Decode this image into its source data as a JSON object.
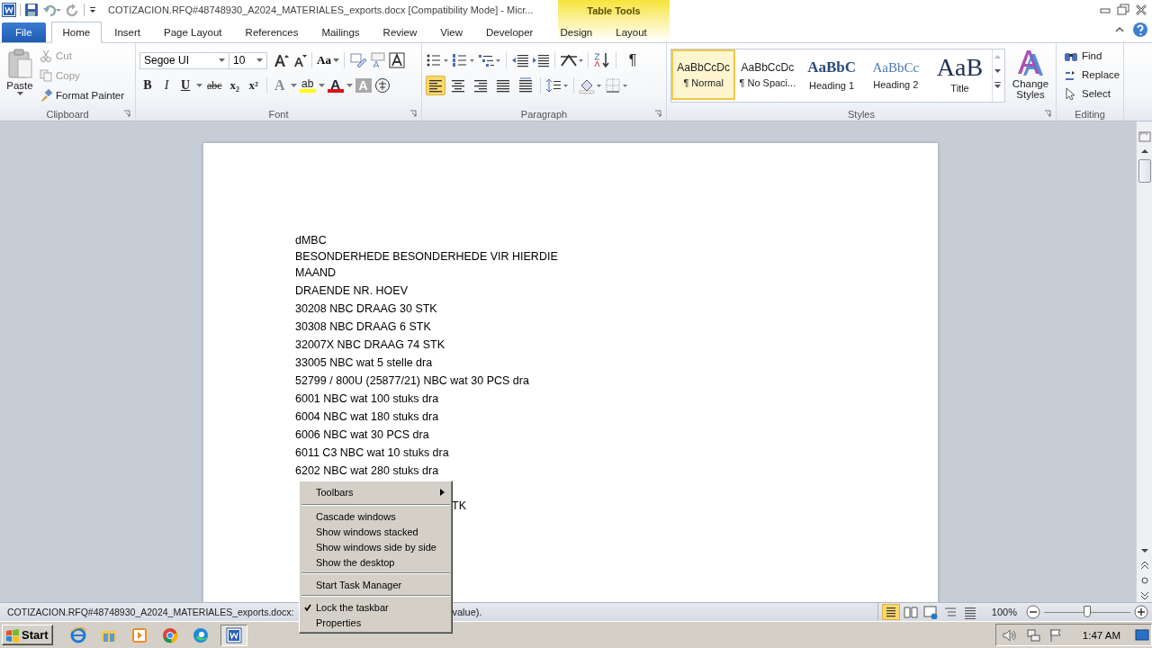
{
  "window": {
    "title": "COTIZACION.RFQ#48748930_A2024_MATERIALES_exports.docx [Compatibility Mode]  -  Micr...",
    "contextual_group": "Table Tools"
  },
  "tabs": [
    {
      "label": "File",
      "kind": "file",
      "selected": false
    },
    {
      "label": "Home",
      "kind": "plain",
      "selected": true
    },
    {
      "label": "Insert",
      "kind": "plain",
      "selected": false
    },
    {
      "label": "Page Layout",
      "kind": "plain",
      "selected": false
    },
    {
      "label": "References",
      "kind": "plain",
      "selected": false
    },
    {
      "label": "Mailings",
      "kind": "plain",
      "selected": false
    },
    {
      "label": "Review",
      "kind": "plain",
      "selected": false
    },
    {
      "label": "View",
      "kind": "plain",
      "selected": false
    },
    {
      "label": "Developer",
      "kind": "plain",
      "selected": false
    },
    {
      "label": "Design",
      "kind": "contextual",
      "selected": false
    },
    {
      "label": "Layout",
      "kind": "contextual",
      "selected": false
    }
  ],
  "clipboard": {
    "label": "Clipboard",
    "paste": "Paste",
    "cut": {
      "label": "Cut",
      "disabled": true
    },
    "copy": {
      "label": "Copy",
      "disabled": true
    },
    "format_painter": "Format Painter"
  },
  "font": {
    "label": "Font",
    "face": "Segoe UI",
    "size": "10",
    "case_glyph": "Aa",
    "format_buttons": [
      {
        "glyph": "B",
        "kind": "bold"
      },
      {
        "glyph": "I",
        "kind": "italic"
      },
      {
        "glyph": "U",
        "kind": "underline"
      },
      {
        "glyph": "abc",
        "kind": "strike"
      },
      {
        "glyph": "x₂",
        "kind": "plain"
      },
      {
        "glyph": "x²",
        "kind": "plain"
      },
      {
        "glyph": "A",
        "kind": "effects"
      },
      {
        "glyph": "ab",
        "kind": "highlight"
      },
      {
        "glyph": "A",
        "kind": "color"
      },
      {
        "glyph": "A",
        "kind": "shade"
      }
    ]
  },
  "paragraph": {
    "label": "Paragraph",
    "marks": "¶",
    "alignments": [
      {
        "kind": "left",
        "selected": true
      },
      {
        "kind": "center",
        "selected": false
      },
      {
        "kind": "right",
        "selected": false
      },
      {
        "kind": "justify",
        "selected": false
      },
      {
        "kind": "distributed",
        "selected": false
      }
    ]
  },
  "styles": {
    "label": "Styles",
    "change_styles": "Change Styles",
    "items": [
      {
        "preview": "AaBbCcDc",
        "name": "¶ Normal",
        "kind": "normal",
        "selected": true
      },
      {
        "preview": "AaBbCcDc",
        "name": "¶ No Spaci...",
        "kind": "normal",
        "selected": false
      },
      {
        "preview": "AaBbC",
        "name": "Heading 1",
        "kind": "heading1",
        "selected": false
      },
      {
        "preview": "AaBbCc",
        "name": "Heading 2",
        "kind": "heading2",
        "selected": false
      },
      {
        "preview": "AaB",
        "name": "Title",
        "kind": "title",
        "selected": false
      }
    ]
  },
  "editing": {
    "label": "Editing",
    "find": "Find",
    "replace": "Replace",
    "select": "Select"
  },
  "document": {
    "lines": [
      {
        "text": "dMBC",
        "kind": "line"
      },
      {
        "text": "BESONDERHEDE BESONDERHEDE VIR HIERDIE MAAND",
        "kind": "line"
      },
      {
        "text": "DRAENDE NR. HOEV",
        "kind": "line"
      },
      {
        "text": "30208 NBC DRAAG 30 STK",
        "kind": "line"
      },
      {
        "text": "30308 NBC DRAAG 6 STK",
        "kind": "line"
      },
      {
        "text": "32007X NBC DRAAG 74 STK",
        "kind": "line"
      },
      {
        "text": "33005 NBC wat 5 stelle dra",
        "kind": "line"
      },
      {
        "text": "52799 / 800U (25877/21) NBC wat 30 PCS dra",
        "kind": "line"
      },
      {
        "text": "6001 NBC wat 100 stuks dra",
        "kind": "line"
      },
      {
        "text": "6004 NBC wat 180 stuks dra",
        "kind": "line"
      },
      {
        "text": "6006 NBC wat 30 PCS dra",
        "kind": "line"
      },
      {
        "text": "6011 C3 NBC wat 10 stuks dra",
        "kind": "line"
      },
      {
        "text": "6202 NBC wat 280 stuks dra",
        "kind": "line"
      },
      {
        "text": "TK",
        "kind": "tail"
      }
    ]
  },
  "context_menu": {
    "items": [
      {
        "label": "Toolbars",
        "kind": "submenu",
        "checked": false
      },
      {
        "kind": "separator"
      },
      {
        "label": "Cascade windows",
        "kind": "item",
        "checked": false
      },
      {
        "label": "Show windows stacked",
        "kind": "item",
        "checked": false
      },
      {
        "label": "Show windows side by side",
        "kind": "item",
        "checked": false
      },
      {
        "label": "Show the desktop",
        "kind": "item",
        "checked": false
      },
      {
        "kind": "separator"
      },
      {
        "label": "Start Task Manager",
        "kind": "item",
        "checked": false
      },
      {
        "kind": "separator"
      },
      {
        "label": "Lock the taskbar",
        "kind": "item",
        "checked": true
      },
      {
        "label": "Properties",
        "kind": "item",
        "checked": false
      }
    ]
  },
  "status_bar": {
    "text": "COTIZACION.RFQ#48748930_A2024_MATERIALES_exports.docx:",
    "tail": "value).",
    "views": [
      {
        "kind": "print",
        "selected": true
      },
      {
        "kind": "reading",
        "selected": false
      },
      {
        "kind": "web",
        "selected": false
      },
      {
        "kind": "outline",
        "selected": false
      },
      {
        "kind": "draft",
        "selected": false
      }
    ],
    "zoom": "100%",
    "zoom_slider": {
      "level": 0.5
    }
  },
  "taskbar": {
    "start": "Start",
    "apps": [
      {
        "kind": "ie",
        "selected": false
      },
      {
        "kind": "explorer",
        "selected": false
      },
      {
        "kind": "media",
        "selected": false
      },
      {
        "kind": "chrome",
        "selected": false
      },
      {
        "kind": "edge",
        "selected": false
      },
      {
        "kind": "word",
        "selected": true
      }
    ],
    "clock": "1:47 AM"
  }
}
